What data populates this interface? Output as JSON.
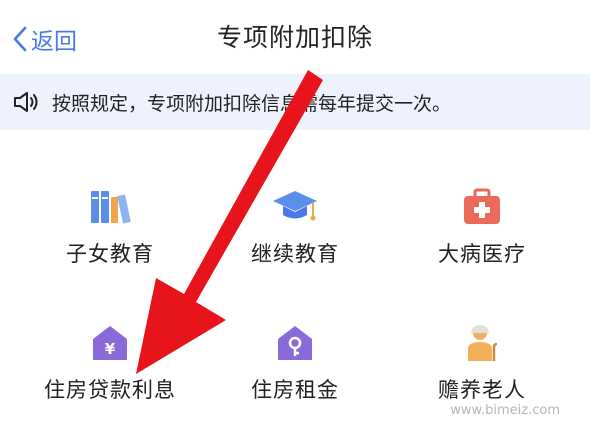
{
  "nav": {
    "back_label": "返回",
    "title": "专项附加扣除"
  },
  "notice": {
    "text": "按照规定，专项附加扣除信息需每年提交一次。"
  },
  "items": [
    {
      "label": "子女教育",
      "icon": "books-icon"
    },
    {
      "label": "继续教育",
      "icon": "graduation-cap-icon"
    },
    {
      "label": "大病医疗",
      "icon": "medical-kit-icon"
    },
    {
      "label": "住房贷款利息",
      "icon": "house-yuan-icon"
    },
    {
      "label": "住房租金",
      "icon": "house-key-icon"
    },
    {
      "label": "赡养老人",
      "icon": "elderly-person-icon"
    }
  ],
  "colors": {
    "accent": "#4a78e8",
    "annotation_arrow": "#e8141b",
    "notice_bg": "#eef2fc"
  },
  "watermark": "www.bimeiz.com"
}
